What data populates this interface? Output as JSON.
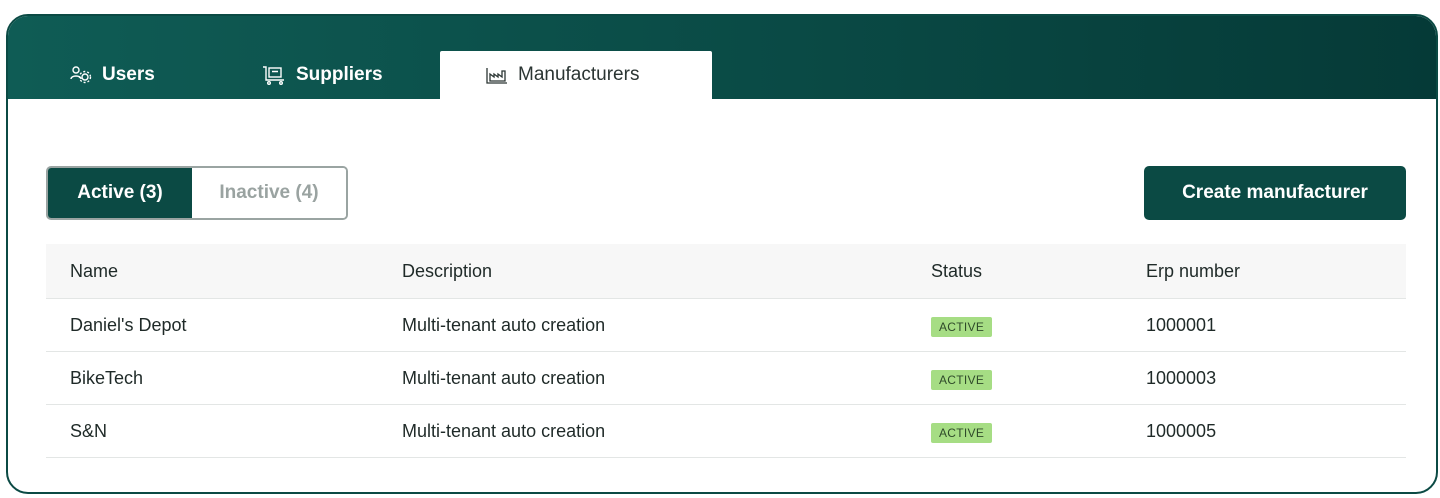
{
  "tabs": [
    {
      "label": "Users",
      "icon": "users-gear-icon"
    },
    {
      "label": "Suppliers",
      "icon": "supplier-icon"
    },
    {
      "label": "Manufacturers",
      "icon": "factory-icon",
      "active": true
    }
  ],
  "filter": {
    "active_label": "Active (3)",
    "inactive_label": "Inactive (4)"
  },
  "actions": {
    "create_label": "Create manufacturer"
  },
  "table": {
    "columns": [
      "Name",
      "Description",
      "Status",
      "Erp number"
    ],
    "rows": [
      {
        "name": "Daniel's Depot",
        "description": "Multi-tenant auto creation",
        "status": "ACTIVE",
        "erp": "1000001"
      },
      {
        "name": "BikeTech",
        "description": "Multi-tenant auto creation",
        "status": "ACTIVE",
        "erp": "1000003"
      },
      {
        "name": "S&N",
        "description": "Multi-tenant auto creation",
        "status": "ACTIVE",
        "erp": "1000005"
      }
    ]
  },
  "colors": {
    "brand": "#0b4a44",
    "status_active_bg": "#a6dd84"
  }
}
